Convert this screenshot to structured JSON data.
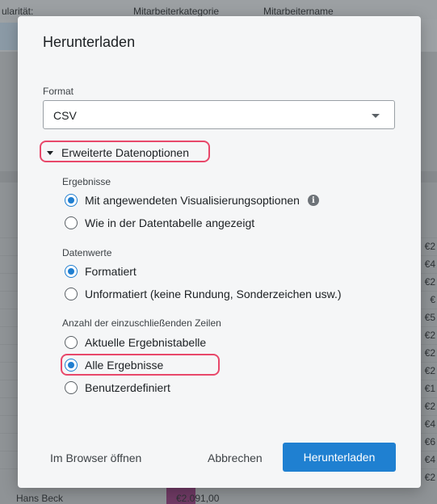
{
  "background": {
    "header_cols": [
      "ularität:",
      "Mitarbeiterkategorie",
      "Mitarbeitername"
    ],
    "row_values": [
      "€2",
      "€4",
      "€2",
      "€",
      "€5",
      "€2",
      "€2",
      "€2",
      "€1",
      "€2",
      "€4",
      "€6",
      "€4",
      "€2"
    ],
    "bottom_name": "Hans Beck",
    "bottom_value": "€2.091,00"
  },
  "modal": {
    "title": "Herunterladen",
    "format": {
      "label": "Format",
      "value": "CSV"
    },
    "advanced_toggle": "Erweiterte Datenoptionen",
    "results": {
      "label": "Ergebnisse",
      "options": [
        {
          "label": "Mit angewendeten Visualisierungsoptionen",
          "checked": true
        },
        {
          "label": "Wie in der Datentabelle angezeigt",
          "checked": false
        }
      ]
    },
    "values": {
      "label": "Datenwerte",
      "options": [
        {
          "label": "Formatiert",
          "checked": true
        },
        {
          "label": "Unformatiert (keine Rundung, Sonderzeichen usw.)",
          "checked": false
        }
      ]
    },
    "rows": {
      "label": "Anzahl der einzuschließenden Zeilen",
      "options": [
        {
          "label": "Aktuelle Ergebnistabelle",
          "checked": false
        },
        {
          "label": "Alle Ergebnisse",
          "checked": true
        },
        {
          "label": "Benutzerdefiniert",
          "checked": false
        }
      ]
    },
    "footer": {
      "open_browser": "Im Browser öffnen",
      "cancel": "Abbrechen",
      "download": "Herunterladen"
    }
  },
  "colors": {
    "accent": "#1f80d1",
    "highlight": "#e8486a"
  },
  "icons": {
    "info": "info-icon",
    "dropdown": "chevron-down-icon",
    "toggle": "caret-down-icon"
  }
}
